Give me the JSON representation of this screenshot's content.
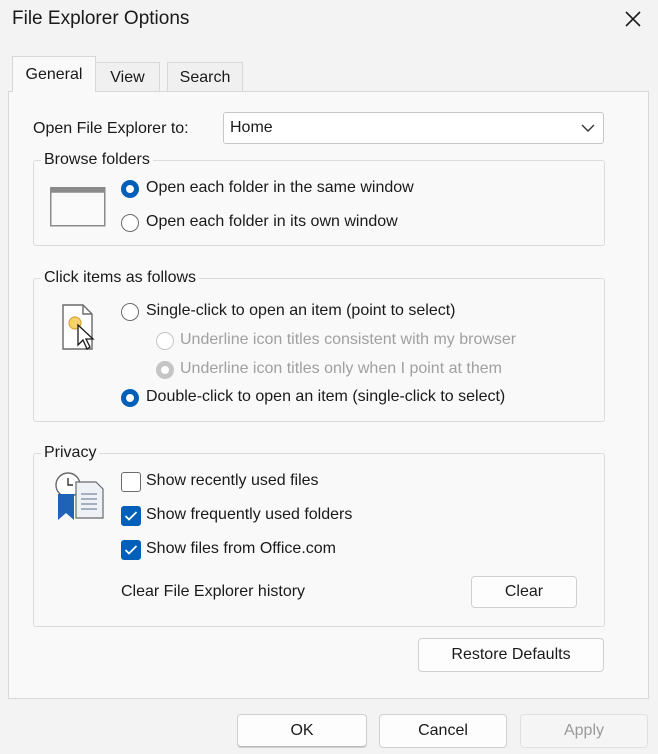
{
  "window": {
    "title": "File Explorer Options"
  },
  "tabs": [
    {
      "label": "General",
      "active": true
    },
    {
      "label": "View",
      "active": false
    },
    {
      "label": "Search",
      "active": false
    }
  ],
  "open_to": {
    "label": "Open File Explorer to:",
    "value": "Home"
  },
  "browse_folders": {
    "title": "Browse folders",
    "options": [
      {
        "label": "Open each folder in the same window",
        "selected": true
      },
      {
        "label": "Open each folder in its own window",
        "selected": false
      }
    ]
  },
  "click_items": {
    "title": "Click items as follows",
    "single": "Single-click to open an item (point to select)",
    "underline_browser": "Underline icon titles consistent with my browser",
    "underline_point": "Underline icon titles only when I point at them",
    "double": "Double-click to open an item (single-click to select)"
  },
  "privacy": {
    "title": "Privacy",
    "show_recent": {
      "label": "Show recently used files",
      "checked": false
    },
    "show_frequent": {
      "label": "Show frequently used folders",
      "checked": true
    },
    "show_office": {
      "label": "Show files from Office.com",
      "checked": true
    },
    "clear_history_label": "Clear File Explorer history",
    "clear_button": "Clear"
  },
  "restore_defaults": "Restore Defaults",
  "buttons": {
    "ok": "OK",
    "cancel": "Cancel",
    "apply": "Apply"
  },
  "colors": {
    "accent": "#005fb8",
    "background": "#f3f3f3",
    "panel": "#f9f9f9"
  }
}
